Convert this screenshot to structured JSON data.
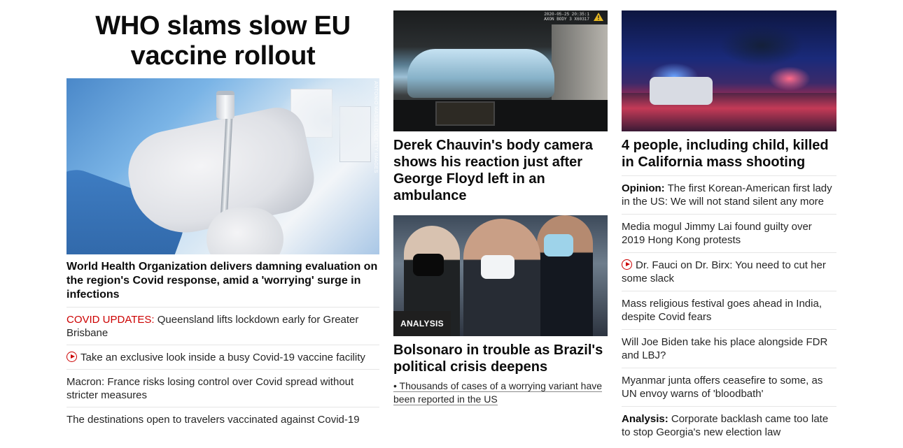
{
  "main": {
    "headline": "WHO slams slow EU vaccine rollout",
    "image_credit": "ANTONIO MASIELLO/GETTY IMAGES",
    "lede": "World Health Organization delivers damning evaluation on the region's Covid response, amid a 'worrying' surge in infections",
    "stories": [
      {
        "prefix": "COVID UPDATES:",
        "text": "Queensland lifts lockdown early for Greater Brisbane"
      },
      {
        "text": "Take an exclusive look inside a busy Covid-19 vaccine facility"
      },
      {
        "text": "Macron: France risks losing control over Covid spread without stricter measures"
      },
      {
        "text": "The destinations open to travelers vaccinated against Covid-19"
      }
    ]
  },
  "middle": {
    "card1": {
      "camera_stamp_line1": "2020-05-25 20:35:1",
      "camera_stamp_line2": "AXON BODY 3 X60317",
      "headline": "Derek Chauvin's body camera shows his reaction just after George Floyd left in an ambulance"
    },
    "card2": {
      "badge": "ANALYSIS",
      "headline": "Bolsonaro in trouble as Brazil's political crisis deepens",
      "bullet": "• Thousands of cases of a worrying variant have been reported in the US"
    }
  },
  "right": {
    "card": {
      "headline": "4 people, including child, killed in California mass shooting"
    },
    "stories": [
      {
        "prefix": "Opinion:",
        "text": "The first Korean-American first lady in the US: We will not stand silent any more"
      },
      {
        "text": "Media mogul Jimmy Lai found guilty over 2019 Hong Kong protests"
      },
      {
        "text": "Dr. Fauci on Dr. Birx: You need to cut her some slack"
      },
      {
        "text": "Mass religious festival goes ahead in India, despite Covid fears"
      },
      {
        "text": "Will Joe Biden take his place alongside FDR and LBJ?"
      },
      {
        "text": "Myanmar junta offers ceasefire to some, as UN envoy warns of 'bloodbath'"
      },
      {
        "prefix": "Analysis:",
        "text": "Corporate backlash came too late to stop Georgia's new election law"
      }
    ]
  },
  "colors": {
    "accent_red": "#cc0000",
    "text": "#262626",
    "badge_bg": "#1f1f1f",
    "divider": "#e6e6e6"
  },
  "icons": {
    "video": "play-icon",
    "warning": "warning-icon"
  }
}
